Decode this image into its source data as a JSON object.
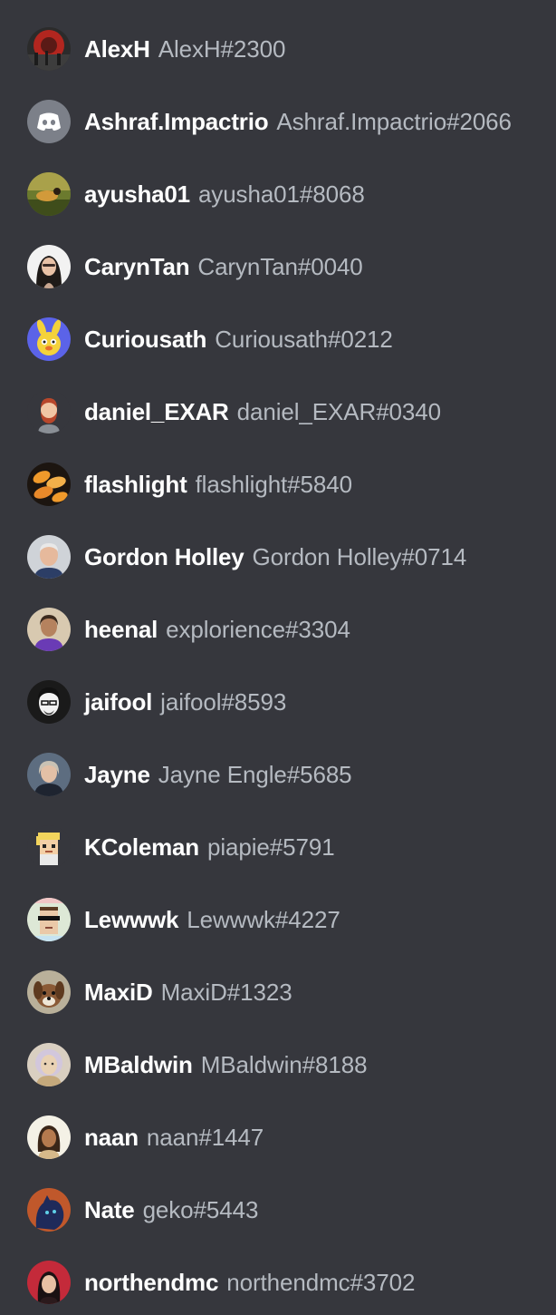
{
  "members": [
    {
      "display_name": "AlexH",
      "username": "AlexH#2300",
      "avatar_icon": "red-circle-photo-icon"
    },
    {
      "display_name": "Ashraf.Impactrio",
      "username": "Ashraf.Impactrio#2066",
      "avatar_icon": "discord-default-avatar-icon"
    },
    {
      "display_name": "ayusha01",
      "username": "ayusha01#8068",
      "avatar_icon": "outdoor-photo-icon"
    },
    {
      "display_name": "CarynTan",
      "username": "CarynTan#0040",
      "avatar_icon": "woman-portrait-icon"
    },
    {
      "display_name": "Curiousath",
      "username": "Curiousath#0212",
      "avatar_icon": "cartoon-bunny-icon"
    },
    {
      "display_name": "daniel_EXAR",
      "username": "daniel_EXAR#0340",
      "avatar_icon": "bearded-man-cartoon-icon"
    },
    {
      "display_name": "flashlight",
      "username": "flashlight#5840",
      "avatar_icon": "orange-pattern-icon"
    },
    {
      "display_name": "Gordon Holley",
      "username": "Gordon Holley#0714",
      "avatar_icon": "man-portrait-icon"
    },
    {
      "display_name": "heenal",
      "username": "explorience#3304",
      "avatar_icon": "man-purple-shirt-icon"
    },
    {
      "display_name": "jaifool",
      "username": "jaifool#8593",
      "avatar_icon": "sketch-portrait-icon"
    },
    {
      "display_name": "Jayne",
      "username": "Jayne Engle#5685",
      "avatar_icon": "woman-photo-icon"
    },
    {
      "display_name": "KColeman",
      "username": "piapie#5791",
      "avatar_icon": "pixel-character-icon"
    },
    {
      "display_name": "Lewwwk",
      "username": "Lewwwk#4227",
      "avatar_icon": "pixel-punk-icon"
    },
    {
      "display_name": "MaxiD",
      "username": "MaxiD#1323",
      "avatar_icon": "dog-photo-icon"
    },
    {
      "display_name": "MBaldwin",
      "username": "MBaldwin#8188",
      "avatar_icon": "illustrated-face-icon"
    },
    {
      "display_name": "naan",
      "username": "naan#1447",
      "avatar_icon": "woman-portrait-icon"
    },
    {
      "display_name": "Nate",
      "username": "geko#5443",
      "avatar_icon": "panther-art-icon"
    },
    {
      "display_name": "northendmc",
      "username": "northendmc#3702",
      "avatar_icon": "woman-red-background-icon"
    }
  ],
  "colors": {
    "background": "#36373d",
    "display_name": "#ffffff",
    "username": "#b5bac1",
    "discord_blurple_grey": "#7c8089"
  }
}
